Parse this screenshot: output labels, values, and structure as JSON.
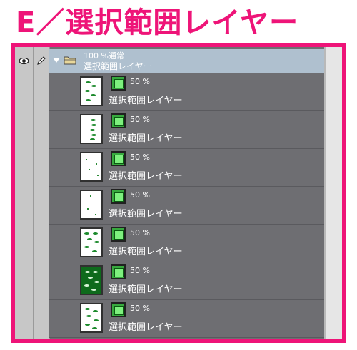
{
  "title": "E／選択範囲レイヤー",
  "group": {
    "line1": "100 %通常",
    "line2": "選択範囲レイヤー"
  },
  "layers": [
    {
      "percent": "50 %",
      "name": "選択範囲レイヤー"
    },
    {
      "percent": "50 %",
      "name": "選択範囲レイヤー"
    },
    {
      "percent": "50 %",
      "name": "選択範囲レイヤー"
    },
    {
      "percent": "50 %",
      "name": "選択範囲レイヤー"
    },
    {
      "percent": "50 %",
      "name": "選択範囲レイヤー"
    },
    {
      "percent": "50 %",
      "name": "選択範囲レイヤー"
    },
    {
      "percent": "50 %",
      "name": "選択範囲レイヤー"
    }
  ],
  "colors": {
    "accent_frame": "#ee1478",
    "panel_bg": "#6e6e72",
    "group_row_bg": "#afc0cf",
    "mask_green": "#37a93e"
  },
  "icons": {
    "visibility": "eye-icon",
    "edit": "pen-icon",
    "expand": "triangle-down-icon",
    "group": "folder-icon",
    "mask": "selection-mask-icon"
  }
}
